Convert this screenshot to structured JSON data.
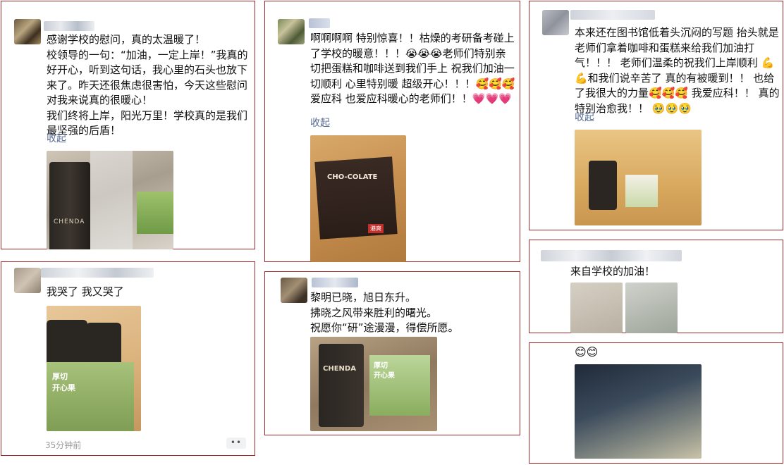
{
  "posts": [
    {
      "text": "感谢学校的慰问，真的太温暖了！\n校领导的一句：“加油，一定上岸！”我真的好开心，听到这句话，我心里的石头也放下来了。昨天还很焦虑很害怕，今天这些慰问对我来说真的很暖心！\n我们终将上岸，阳光万里！学校真的是我们最坚强的后盾！",
      "collapse": "收起",
      "photo_labels": [
        "CHENDA"
      ]
    },
    {
      "text": "啊啊啊啊 特别惊喜！！枯燥的考研备考碰上了学校的暖意！！！😭😭😭老师们特别亲切把蛋糕和咖啡送到我们手上 祝我们加油一切顺利 心里特别暖 超级开心！！！🥰🥰🥰 爱应科 也爱应科暖心的老师们！！💗💗💗",
      "collapse": "收起",
      "photo_labels": [
        "CHO-COLATE",
        "港爽"
      ]
    },
    {
      "text": "本来还在图书馆低着头沉闷的写题 抬头就是老师们拿着咖啡和蛋糕来给我们加油打气！！！ 老师们温柔的祝我们上岸顺利 💪💪和我们说辛苦了 真的有被暖到！！ 也给了我很大的力量🥰🥰🥰 我爱应科！！ 真的特别治愈我！！ 🥹🥹🥹",
      "collapse": "收起"
    },
    {
      "text": "我哭了 我又哭了",
      "photo_labels": [
        "厚切",
        "开心果"
      ],
      "time": "35分钟前",
      "more": "••"
    },
    {
      "text": "黎明已晓，旭日东升。\n拂晓之风带来胜利的曙光。\n祝愿你“研”途漫漫，得偿所愿。",
      "photo_labels": [
        "CHENDA",
        "厚切",
        "开心果"
      ]
    },
    {
      "text": "来自学校的加油！"
    },
    {
      "text": "😊😊"
    }
  ],
  "colors": {
    "frame": "#a3272b",
    "link": "#576b95",
    "time": "#9a9a9a"
  }
}
